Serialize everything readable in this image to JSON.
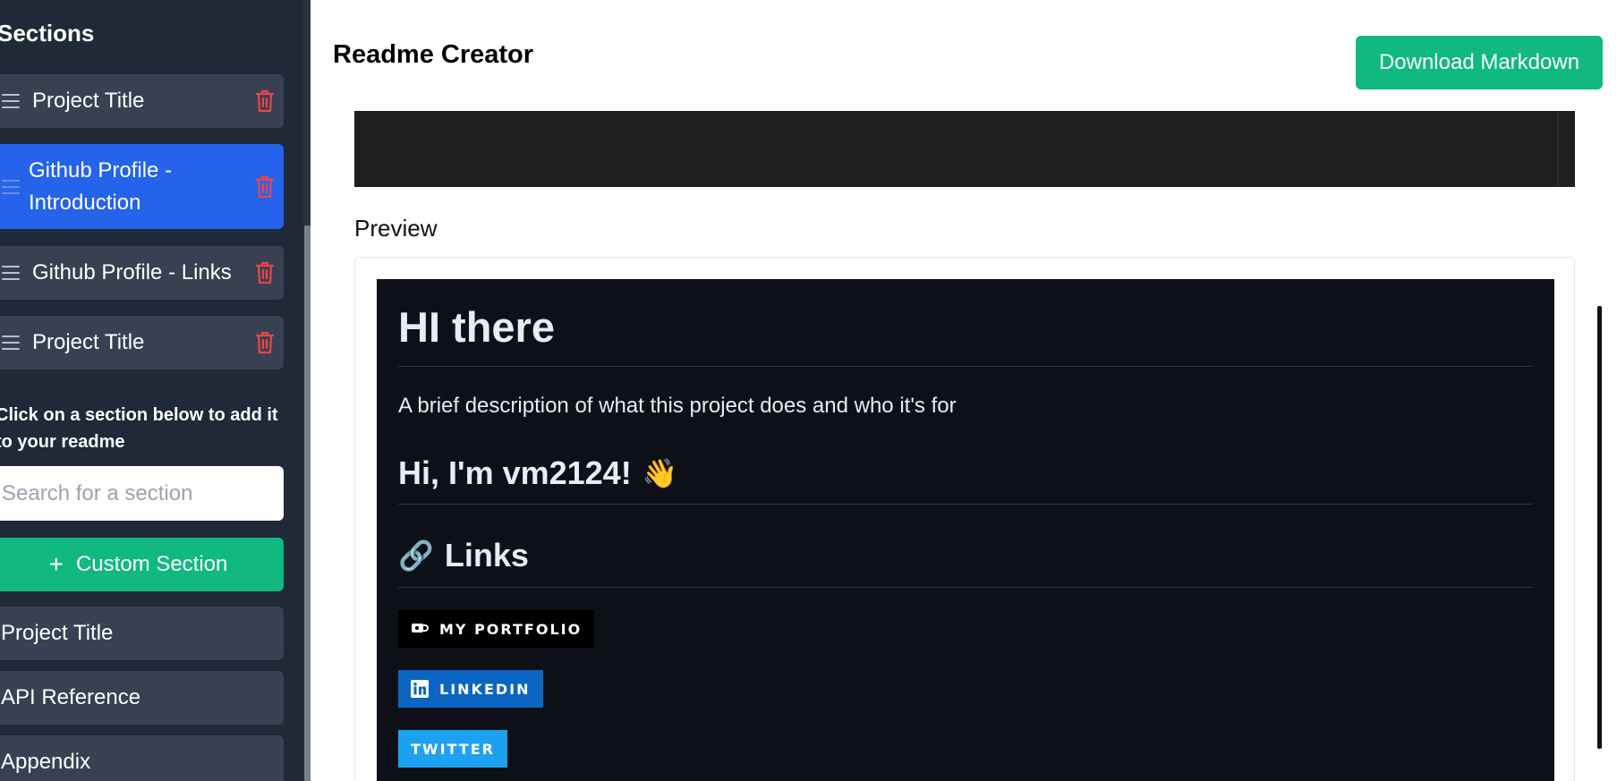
{
  "sidebar": {
    "title": "Sections",
    "active_sections": [
      {
        "label": "Project Title"
      },
      {
        "label_line1": "Github Profile -",
        "label_line2": "Introduction"
      },
      {
        "label": "Github Profile - Links"
      },
      {
        "label": "Project Title"
      }
    ],
    "hint_line1": "Click on a section below to add it",
    "hint_line2": "to your readme",
    "search": {
      "placeholder": "Search for a section",
      "value": ""
    },
    "custom_section_label": "Custom Section",
    "templates": [
      {
        "label": "Project Title"
      },
      {
        "label": "API Reference"
      },
      {
        "label": "Appendix"
      }
    ]
  },
  "header": {
    "title": "Readme Creator",
    "download_label": "Download Markdown"
  },
  "preview": {
    "label": "Preview",
    "h1": "HI there",
    "description": "A brief description of what this project does and who it's for",
    "h2_intro": "Hi, I'm vm2124!",
    "h2_intro_emoji": "👋",
    "h2_links": "Links",
    "h2_links_emoji": "🔗",
    "badges": [
      {
        "label": "MY PORTFOLIO",
        "color": "#000000",
        "icon": "coffee-icon"
      },
      {
        "label": "LINKEDIN",
        "color": "#0a66c2",
        "icon": "linkedin-icon"
      },
      {
        "label": "TWITTER",
        "color": "#1da1f2",
        "icon": "twitter-icon"
      }
    ]
  },
  "colors": {
    "sidebar_bg": "#1f2937",
    "section_bg": "#374151",
    "selected_bg": "#2563eb",
    "accent_green": "#10b981",
    "delete_red": "#ef4444",
    "preview_bg": "#0d1117",
    "editor_bg": "#1e1e1e"
  }
}
